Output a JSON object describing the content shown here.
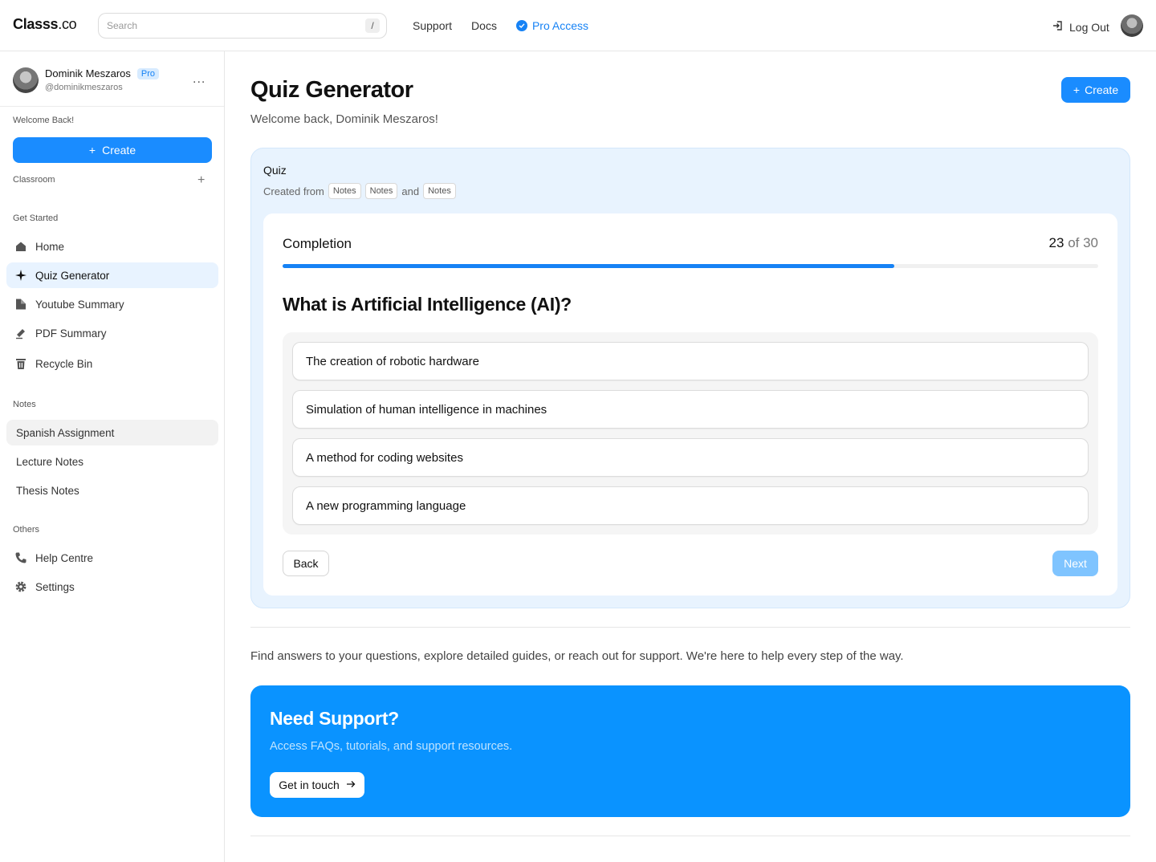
{
  "header": {
    "logo_bold": "Classs",
    "logo_suffix": ".co",
    "search_placeholder": "Search",
    "search_shortcut": "/",
    "nav": [
      "Support",
      "Docs",
      "Pro Access"
    ],
    "logout": "Log Out"
  },
  "sidebar": {
    "profile": {
      "name": "Dominik Meszaros",
      "badge": "Pro",
      "handle": "@dominikmeszaros",
      "more": "..."
    },
    "welcome": "Welcome Back!",
    "create": "Create",
    "classroom": "Classroom",
    "sections": {
      "get_started": "Get Started",
      "notes": "Notes",
      "others": "Others"
    },
    "get_started_items": [
      {
        "label": "Home",
        "icon": "home-icon"
      },
      {
        "label": "Quiz Generator",
        "icon": "sparkle-icon"
      },
      {
        "label": "Youtube Summary",
        "icon": "document-icon"
      },
      {
        "label": "PDF Summary",
        "icon": "pen-icon"
      },
      {
        "label": "Recycle Bin",
        "icon": "trash-icon"
      }
    ],
    "notes_items": [
      "Spanish Assignment",
      "Lecture Notes",
      "Thesis Notes"
    ],
    "others_items": [
      {
        "label": "Help Centre",
        "icon": "phone-icon"
      },
      {
        "label": "Settings",
        "icon": "gear-icon"
      }
    ]
  },
  "main": {
    "title": "Quiz Generator",
    "welcome": "Welcome back, Dominik Meszaros!",
    "create": "Create",
    "quiz": {
      "title": "Quiz",
      "created_from": "Created from",
      "chips": [
        "Notes",
        "Notes",
        "Notes"
      ],
      "and": "and",
      "completion_label": "Completion",
      "current": "23",
      "of_total": "of 30",
      "progress": 0.75,
      "question": "What is Artificial Intelligence (AI)?",
      "options": [
        "The creation of robotic hardware",
        "Simulation of human intelligence in machines",
        "A method for coding websites",
        "A new programming language"
      ],
      "back": "Back",
      "next": "Next"
    },
    "help_text": "Find answers to your questions, explore detailed guides, or reach out for support. We're here to help every step of the way.",
    "support": {
      "title": "Need Support?",
      "subtitle": "Access FAQs, tutorials, and support resources.",
      "button": "Get in touch"
    }
  },
  "colors": {
    "accent": "#1a8cff",
    "support_bg": "#0a93ff",
    "panel_bg": "#e8f3fe"
  }
}
